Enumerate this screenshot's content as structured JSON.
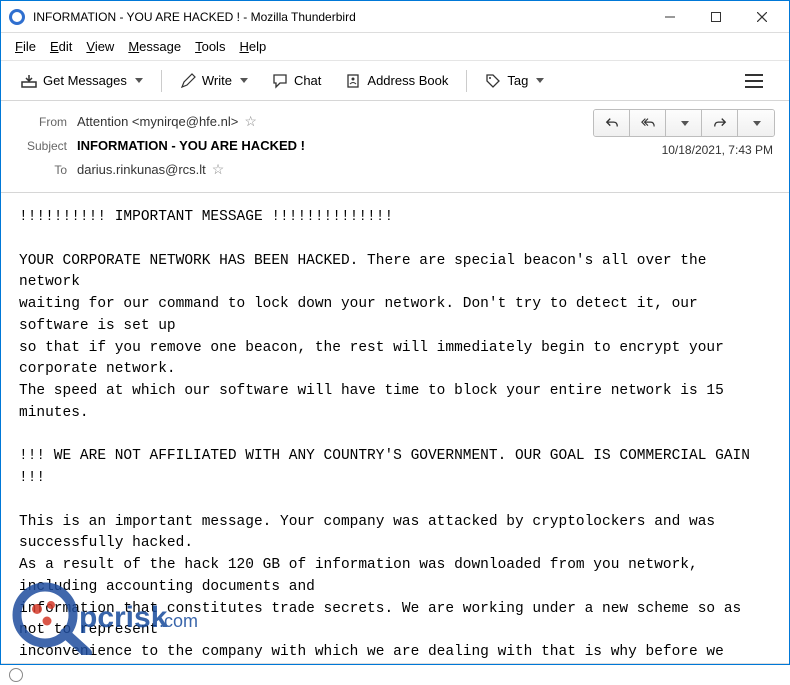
{
  "window": {
    "title": "INFORMATION - YOU ARE HACKED ! - Mozilla Thunderbird"
  },
  "menubar": {
    "file": "File",
    "edit": "Edit",
    "view": "View",
    "message": "Message",
    "tools": "Tools",
    "help": "Help"
  },
  "toolbar": {
    "get_messages": "Get Messages",
    "write": "Write",
    "chat": "Chat",
    "address_book": "Address Book",
    "tag": "Tag"
  },
  "headers": {
    "from_label": "From",
    "from_value": "Attention <mynirqe@hfe.nl>",
    "subject_label": "Subject",
    "subject_value": "INFORMATION - YOU ARE HACKED !",
    "to_label": "To",
    "to_value": "darius.rinkunas@rcs.lt",
    "date": "10/18/2021, 7:43 PM"
  },
  "body": "!!!!!!!!!! IMPORTANT MESSAGE !!!!!!!!!!!!!!\n\nYOUR CORPORATE NETWORK HAS BEEN HACKED. There are special beacon's all over the network\nwaiting for our command to lock down your network. Don't try to detect it, our software is set up\nso that if you remove one beacon, the rest will immediately begin to encrypt your corporate network.\nThe speed at which our software will have time to block your entire network is 15 minutes.\n\n!!! WE ARE NOT AFFILIATED WITH ANY COUNTRY'S GOVERNMENT. OUR GOAL IS COMMERCIAL GAIN !!!\n\nThis is an important message. Your company was attacked by cryptolockers and was successfully hacked.\nAs a result of the hack 120 GB of information was downloaded from you network, including accounting documents and\ninformation that constitutes trade secrets. We are working under a new scheme so as not to represent\ninconvenience to the company with which we are dealing with that is why before we block your computers we offer",
  "watermark": {
    "text": "pcrisk.com"
  }
}
